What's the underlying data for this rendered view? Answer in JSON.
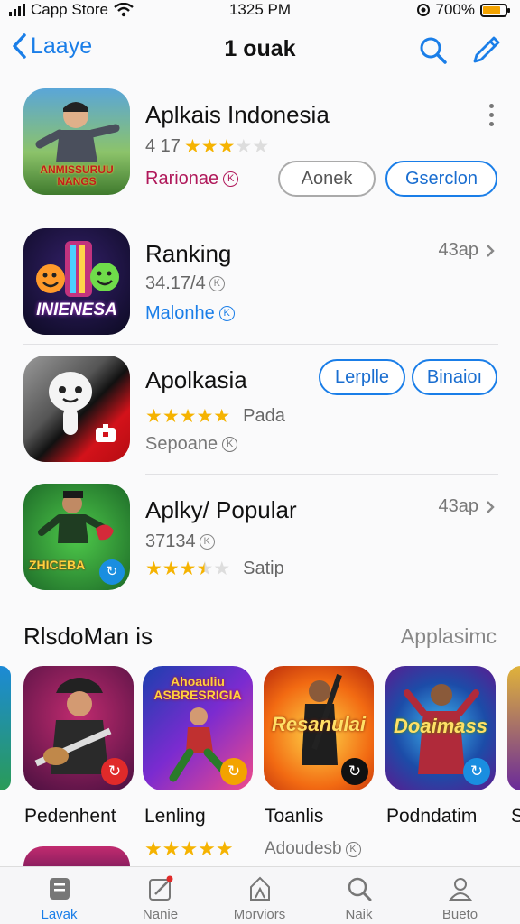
{
  "status": {
    "carrier": "Capp Store",
    "time": "1325 PM",
    "battery": "700%",
    "battery_level": 0.8
  },
  "nav": {
    "back_label": "Laaye",
    "title": "1 ouak"
  },
  "apps": [
    {
      "name": "Aplkais Indonesia",
      "rating_text": "4 17",
      "stars": 3,
      "sub": "Rarionae",
      "sub_color": "#b0185a",
      "icon_text": "ANMISSURUU NANGS",
      "btn1": "Aonek",
      "btn2": "Gserclon"
    },
    {
      "name": "Ranking",
      "rating_text": "34.17/4",
      "sub": "Malonhe",
      "sub_color": "#1a7ee8",
      "icon_text": "INIENESA",
      "right_text": "43ap"
    },
    {
      "name": "Apolkasia",
      "stars": 5,
      "rating_text": "Pada",
      "sub": "Sepoane",
      "sub_color": "#777",
      "btn1": "Lerplle",
      "btn2": "Binaioı"
    },
    {
      "name": "Aplky/ Popular",
      "rating_text": "37134",
      "stars": 3.5,
      "extra": "Satip",
      "icon_text": "ZHICEBA",
      "right_text": "43ap"
    }
  ],
  "section": {
    "title": "RlsdoMan is",
    "link": "Applasimc"
  },
  "tiles": [
    {
      "label": "Pedenhent",
      "icon_text": ""
    },
    {
      "label": "Lenling",
      "icon_text": "Ahoauliu ASBRESRIGIA",
      "stars": 5
    },
    {
      "label": "Toanlis",
      "icon_text": "Resanulai",
      "extra": "Adoudesb"
    },
    {
      "label": "Podndatim",
      "icon_text": "Doaimass"
    }
  ],
  "edge_label": "S",
  "tabs": [
    {
      "label": "Lavak",
      "icon": "grid-icon",
      "active": true
    },
    {
      "label": "Nanie",
      "icon": "edit-icon"
    },
    {
      "label": "Morviors",
      "icon": "apps-icon"
    },
    {
      "label": "Naik",
      "icon": "search-icon"
    },
    {
      "label": "Bueto",
      "icon": "person-icon"
    }
  ],
  "colors": {
    "accent": "#1a7ee8",
    "star": "#f5b301"
  }
}
